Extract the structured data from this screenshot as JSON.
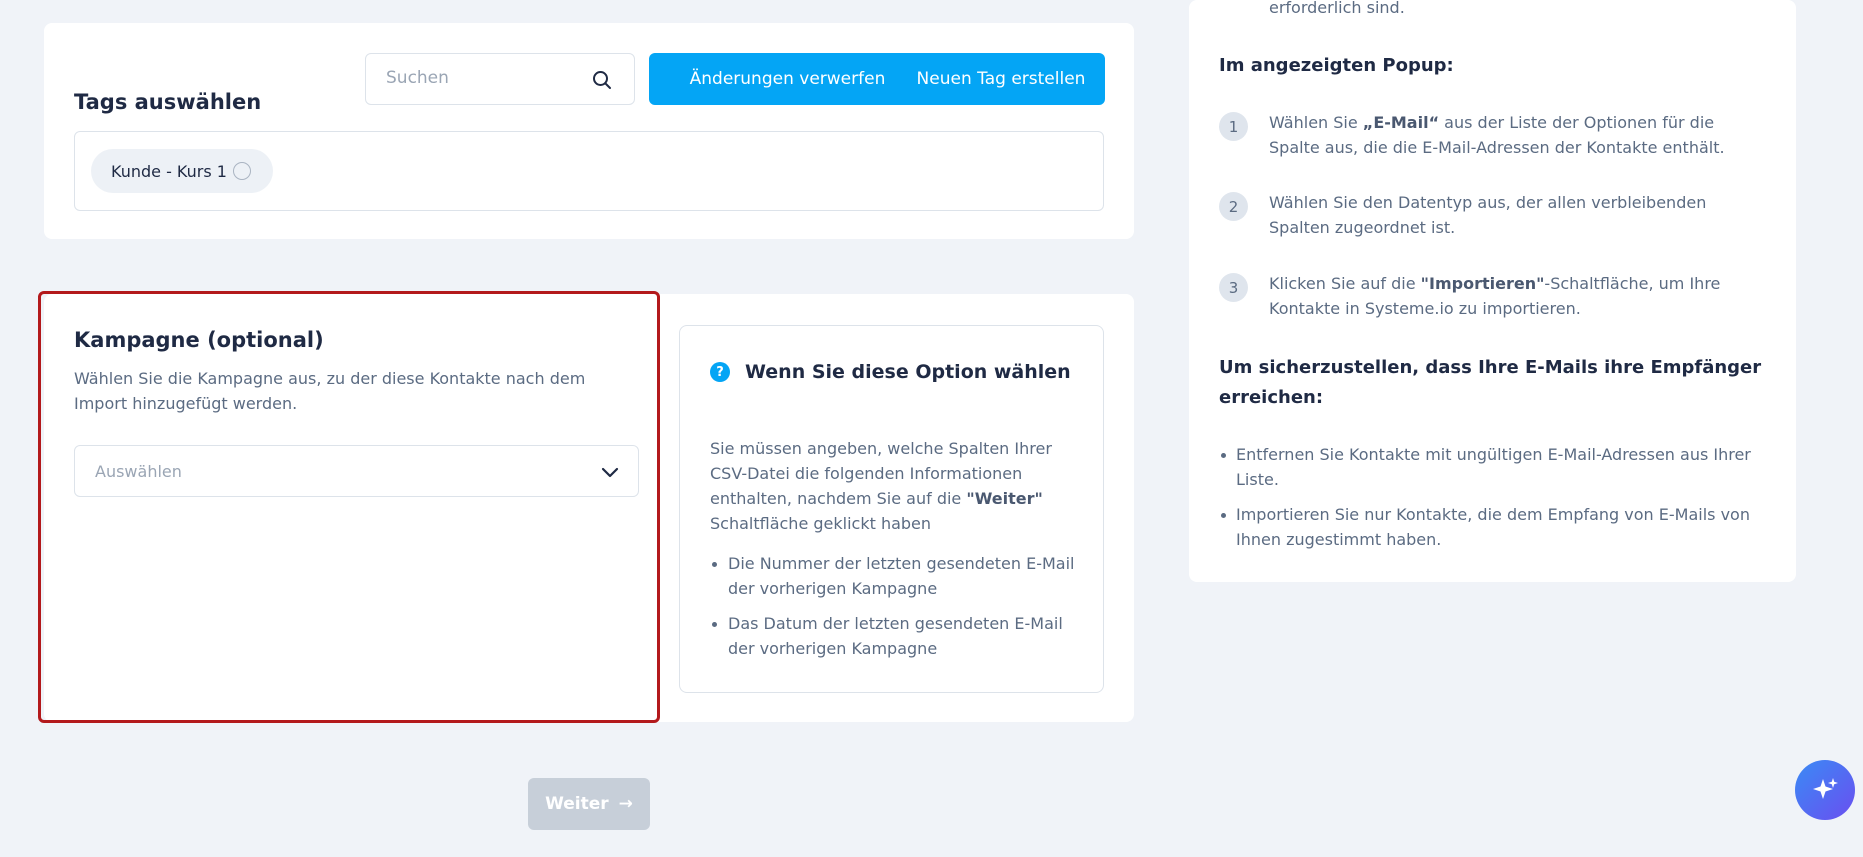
{
  "tags": {
    "title": "Tags auswählen",
    "search_placeholder": "Suchen",
    "discard_label": "Änderungen verwerfen",
    "new_tag_label": "Neuen Tag erstellen",
    "selected": [
      {
        "label": "Kunde - Kurs 1"
      }
    ]
  },
  "campaign": {
    "title": "Kampagne (optional)",
    "description": "Wählen Sie die Kampagne aus, zu der diese Kontakte nach dem Import hinzugefügt werden.",
    "select_placeholder": "Auswählen"
  },
  "info": {
    "icon": "?",
    "title": "Wenn Sie diese Option wählen",
    "text_before": "Sie müssen angeben, welche Spalten Ihrer CSV-Datei die folgenden Informationen enthalten, nachdem Sie auf die ",
    "text_bold": "\"Weiter\"",
    "text_after": " Schaltfläche geklickt haben",
    "items": [
      "Die Nummer der letzten gesendeten E-Mail der vorherigen Kampagne",
      "Das Datum der letzten gesendeten E-Mail der vorherigen Kampagne"
    ]
  },
  "next_button": {
    "label": "Weiter",
    "arrow": "→"
  },
  "help": {
    "top_text": "erforderlich sind.",
    "popup_heading": "Im angezeigten Popup:",
    "steps": [
      {
        "num": "1",
        "before": "Wählen Sie ",
        "bold": "„E-Mail“",
        "after": " aus der Liste der Optionen für die Spalte aus, die die E-Mail-Adressen der Kontakte enthält."
      },
      {
        "num": "2",
        "before": "Wählen Sie den Datentyp aus, der allen verbleibenden Spalten zugeordnet ist.",
        "bold": "",
        "after": ""
      },
      {
        "num": "3",
        "before": "Klicken Sie auf die ",
        "bold": "\"Importieren\"",
        "after": "-Schaltfläche, um Ihre Kontakte in Systeme.io zu importieren."
      }
    ],
    "ensure_heading": "Um sicherzustellen, dass Ihre E-Mails ihre Empfänger erreichen:",
    "bullets": [
      "Entfernen Sie Kontakte mit ungültigen E-Mail-Adressen aus Ihrer Liste.",
      "Importieren Sie nur Kontakte, die dem Empfang von E-Mails von Ihnen zugestimmt haben."
    ]
  },
  "ai_assistant_icon": "sparkles-icon"
}
